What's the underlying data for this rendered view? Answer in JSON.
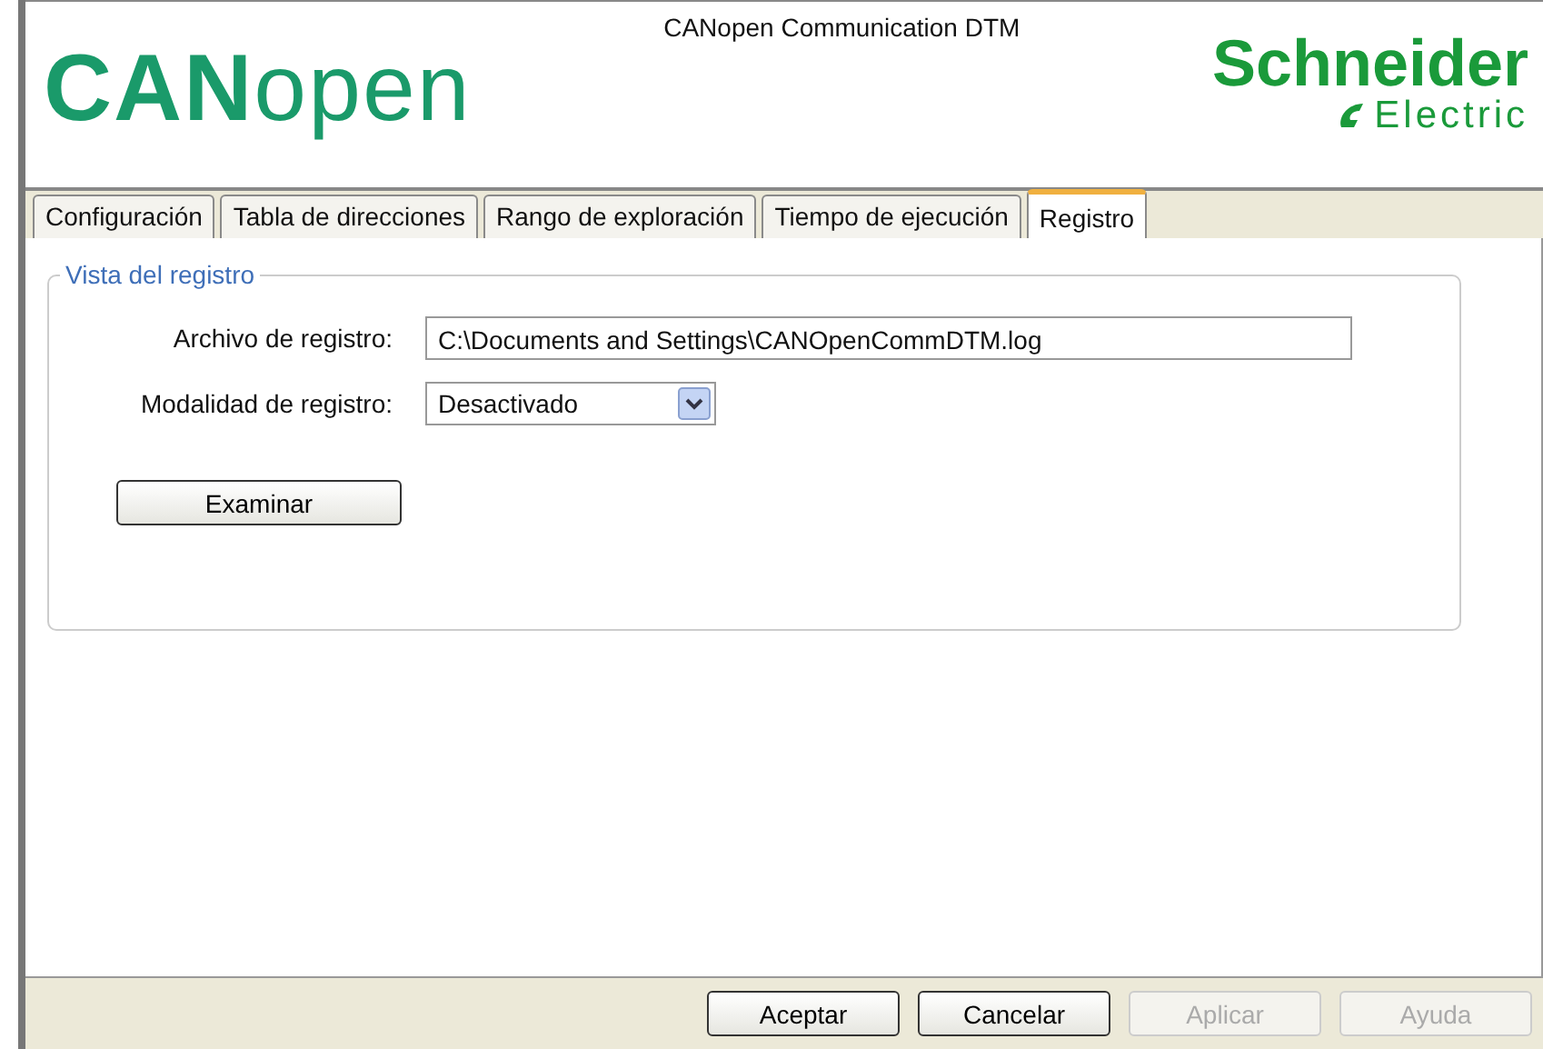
{
  "header": {
    "logo_bold": "CAN",
    "logo_light": "open",
    "title": "CANopen Communication DTM",
    "brand_top": "Schneider",
    "brand_bottom": "Electric"
  },
  "tabs": [
    {
      "label": "Configuración",
      "selected": false
    },
    {
      "label": "Tabla de direcciones",
      "selected": false
    },
    {
      "label": "Rango de exploración",
      "selected": false
    },
    {
      "label": "Tiempo de ejecución",
      "selected": false
    },
    {
      "label": "Registro",
      "selected": true
    }
  ],
  "group": {
    "title": "Vista del registro",
    "fields": [
      {
        "kind": "text",
        "label": "Archivo de registro:",
        "value": "C:\\Documents and Settings\\CANOpenCommDTM.log"
      },
      {
        "kind": "select",
        "label": "Modalidad de registro:",
        "value": "Desactivado"
      }
    ],
    "browse_button": "Examinar"
  },
  "buttons": [
    {
      "label": "Aceptar",
      "disabled": false
    },
    {
      "label": "Cancelar",
      "disabled": false
    },
    {
      "label": "Aplicar",
      "disabled": true
    },
    {
      "label": "Ayuda",
      "disabled": true
    }
  ]
}
